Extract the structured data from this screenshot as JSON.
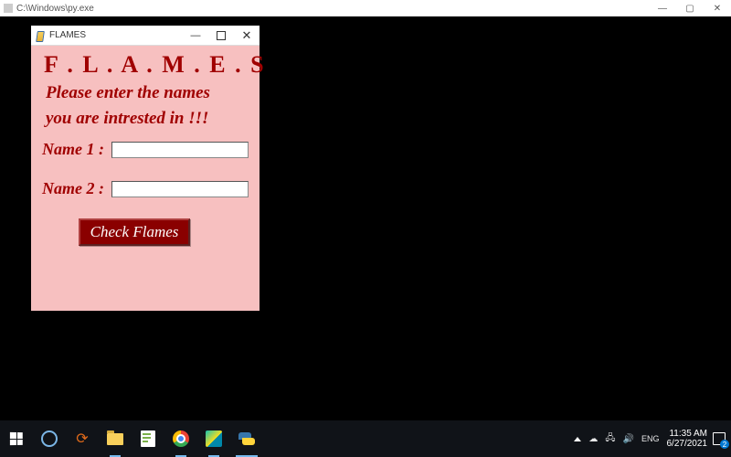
{
  "outer_window": {
    "title": "C:\\Windows\\py.exe",
    "controls": {
      "min": "—",
      "max": "▢",
      "close": "✕"
    }
  },
  "tk_window": {
    "title": "FLAMES",
    "controls": {
      "min": "—",
      "close": "✕"
    },
    "app_title": "F . L . A . M . E . S",
    "instruction_line1": "Please enter the names",
    "instruction_line2": "you are intrested in !!!",
    "name1_label": "Name 1 :",
    "name1_value": "",
    "name2_label": "Name 2 :",
    "name2_value": "",
    "check_button": "Check Flames"
  },
  "taskbar": {
    "items": [
      {
        "name": "start-button"
      },
      {
        "name": "cortana-icon"
      },
      {
        "name": "loop-icon"
      },
      {
        "name": "file-explorer-icon"
      },
      {
        "name": "notepad-plus-icon"
      },
      {
        "name": "chrome-icon"
      },
      {
        "name": "pycharm-icon"
      },
      {
        "name": "python-icon"
      }
    ],
    "time": "11:35 AM",
    "date": "6/27/2021",
    "notifications": "2"
  }
}
